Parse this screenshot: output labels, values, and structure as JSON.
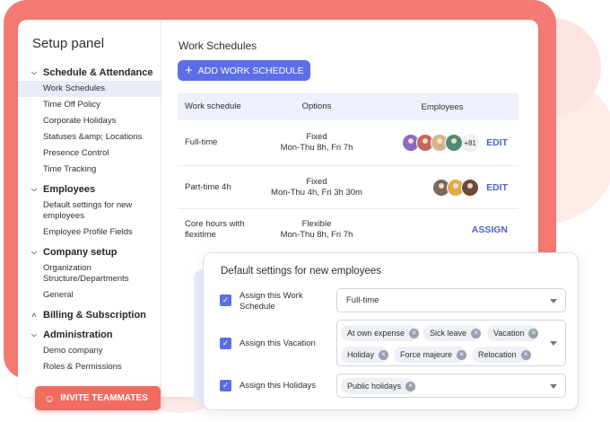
{
  "sidebar": {
    "title": "Setup panel",
    "groups": [
      {
        "label": "Schedule & Attendance",
        "items": [
          "Work Schedules",
          "Time Off Policy",
          "Corporate Holidays",
          "Statuses &amp; Locations",
          "Presence Control",
          "Time Tracking"
        ]
      },
      {
        "label": "Employees",
        "items": [
          "Default settings for new employees",
          "Employee Profile Fields"
        ]
      },
      {
        "label": "Company setup",
        "items": [
          "Organization Structure/Departments",
          "General"
        ]
      },
      {
        "label": "Billing & Subscription",
        "items": []
      },
      {
        "label": "Administration",
        "items": [
          "Demo company",
          "Roles & Permissions"
        ]
      }
    ],
    "active_item": "Work Schedules"
  },
  "content": {
    "title": "Work Schedules",
    "add_button": "ADD WORK SCHEDULE",
    "table": {
      "headers": [
        "Work schedule",
        "Options",
        "Employees"
      ],
      "rows": [
        {
          "name": "Full-time",
          "option_type": "Fixed",
          "option_detail": "Mon-Thu 8h, Fri 7h",
          "more": "+81",
          "action": "EDIT"
        },
        {
          "name": "Part-time 4h",
          "option_type": "Fixed",
          "option_detail": "Mon-Thu 4h, Fri 3h 30m",
          "more": "",
          "action": "EDIT"
        },
        {
          "name": "Core hours with flexitime",
          "option_type": "Flexible",
          "option_detail": "Mon-Thu 8h, Fri 7h",
          "more": "",
          "action": "ASSIGN"
        }
      ]
    }
  },
  "invite_button": "INVITE TEAMMATES",
  "overlay": {
    "title": "Default settings for new employees",
    "schedule": {
      "label": "Assign this Work Schedule",
      "value": "Full-time"
    },
    "vacation": {
      "label": "Assign this Vacation",
      "chips": [
        "At own expense",
        "Sick leave",
        "Vacation",
        "Holiday",
        "Force majeure",
        "Relocation"
      ]
    },
    "holidays": {
      "label": "Assign this Holidays",
      "chips": [
        "Public holidays"
      ]
    }
  },
  "colors": {
    "accent": "#5b6ee8",
    "brand": "#f47a73",
    "link": "#4a63d6"
  }
}
